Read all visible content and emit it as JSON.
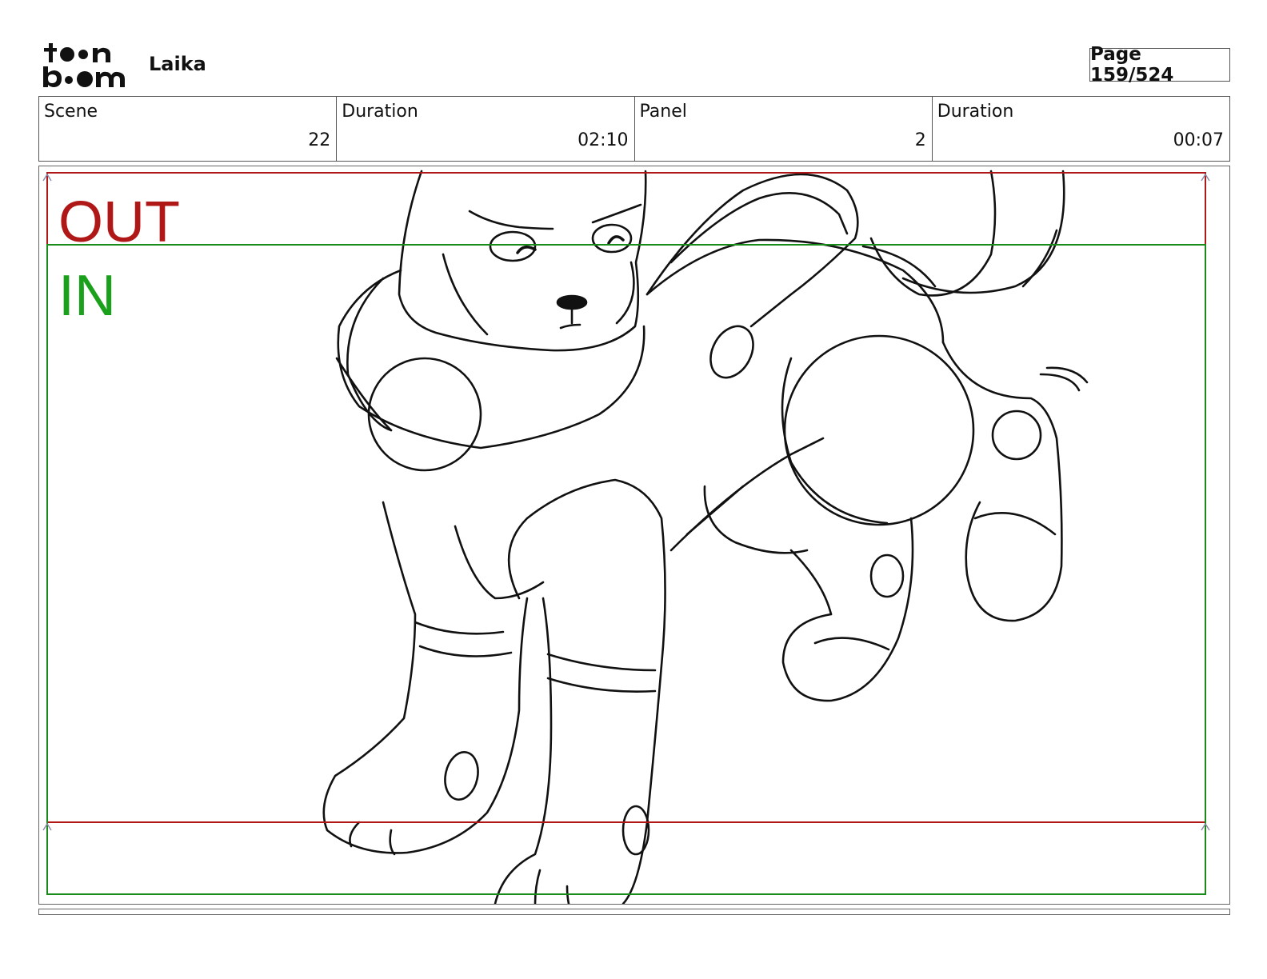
{
  "header": {
    "logo_text": "toon boom",
    "project_name": "Laika",
    "page_label": "Page 159/524"
  },
  "info": {
    "scene": {
      "label": "Scene",
      "value": "22"
    },
    "scene_duration": {
      "label": "Duration",
      "value": "02:10"
    },
    "panel": {
      "label": "Panel",
      "value": "2"
    },
    "panel_duration": {
      "label": "Duration",
      "value": "00:07"
    }
  },
  "frame": {
    "out_label": "OUT",
    "in_label": "IN",
    "out_color": "#b01818",
    "in_color": "#1aa01a"
  }
}
